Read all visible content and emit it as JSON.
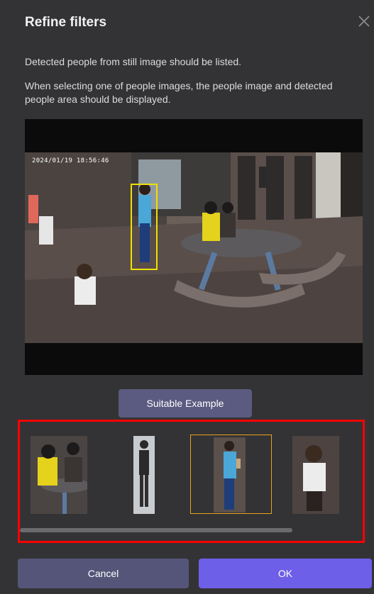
{
  "dialog": {
    "title": "Refine filters",
    "description_1": "Detected people from still image should be listed.",
    "description_2": "When selecting one of people images, the people image and detected people area should be displayed."
  },
  "viewer": {
    "timestamp": "2024/01/19 18:56:46"
  },
  "example_button": {
    "label": "Suitable Example"
  },
  "thumbnails": {
    "count": 4,
    "selected_index": 2
  },
  "footer": {
    "cancel_label": "Cancel",
    "ok_label": "OK"
  },
  "colors": {
    "background": "#333335",
    "primary": "#6d5fe8",
    "secondary": "#55557a",
    "highlight": "#ff0000",
    "selection": "#e6a21e",
    "detection_box": "#f0e000"
  }
}
